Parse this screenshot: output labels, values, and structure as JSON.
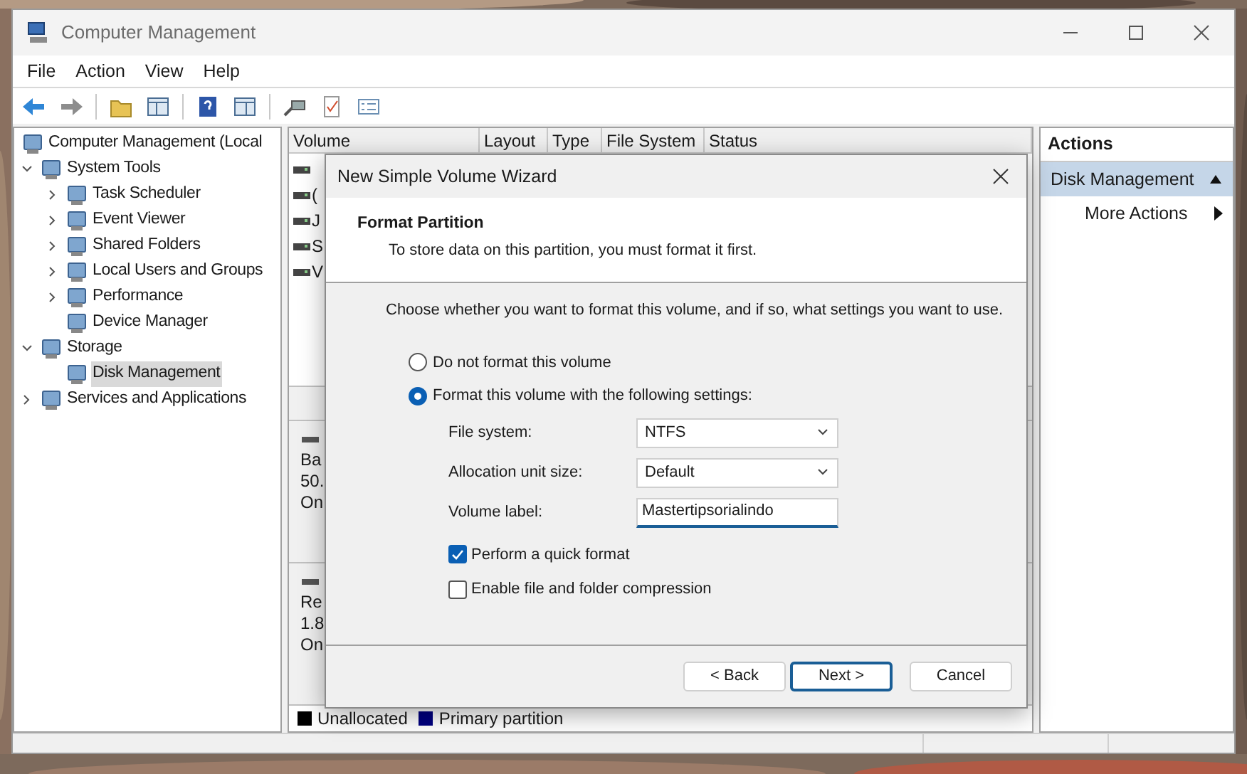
{
  "window": {
    "title": "Computer Management"
  },
  "menu": [
    "File",
    "Action",
    "View",
    "Help"
  ],
  "tree": [
    {
      "label": "Computer Management (Local",
      "selected": false,
      "children": [
        {
          "label": "System Tools",
          "expanded": true,
          "selected": false,
          "children": [
            {
              "label": "Task Scheduler",
              "expanded": false,
              "selected": false
            },
            {
              "label": "Event Viewer",
              "expanded": false,
              "selected": false
            },
            {
              "label": "Shared Folders",
              "expanded": false,
              "selected": false
            },
            {
              "label": "Local Users and Groups",
              "expanded": false,
              "selected": false
            },
            {
              "label": "Performance",
              "expanded": false,
              "selected": false
            },
            {
              "label": "Device Manager",
              "selected": false
            }
          ]
        },
        {
          "label": "Storage",
          "expanded": true,
          "selected": false,
          "children": [
            {
              "label": "Disk Management",
              "selected": true
            }
          ]
        },
        {
          "label": "Services and Applications",
          "expanded": false,
          "selected": false
        }
      ]
    }
  ],
  "volume_table": {
    "columns": [
      "Volume",
      "Layout",
      "Type",
      "File System",
      "Status"
    ],
    "rows": [
      {
        "text": ""
      },
      {
        "text": "("
      },
      {
        "text": "J"
      },
      {
        "text": "S"
      },
      {
        "text": "V"
      }
    ]
  },
  "disks": [
    {
      "lines": [
        "Ba",
        "50.",
        "On"
      ]
    },
    {
      "lines": [
        "Re",
        "1.8",
        "On"
      ]
    }
  ],
  "legend": [
    {
      "label": "Unallocated",
      "color": "#000000"
    },
    {
      "label": "Primary partition",
      "color": "#000080"
    }
  ],
  "actions": {
    "title": "Actions",
    "section": "Disk Management",
    "items": [
      "More Actions"
    ]
  },
  "dialog": {
    "title": "New Simple Volume Wizard",
    "heading": "Format Partition",
    "subheading": "To store data on this partition, you must format it first.",
    "prompt": "Choose whether you want to format this volume, and if so, what settings you want to use.",
    "options": [
      {
        "label": "Do not format this volume",
        "selected": false
      },
      {
        "label": "Format this volume with the following settings:",
        "selected": true
      }
    ],
    "settings": [
      {
        "kind": "dropdown",
        "label": "File system:",
        "value": "NTFS"
      },
      {
        "kind": "dropdown",
        "label": "Allocation unit size:",
        "value": "Default"
      },
      {
        "kind": "text",
        "label": "Volume label:",
        "value": "Mastertipsorialindo"
      }
    ],
    "checkboxes": [
      {
        "label": "Perform a quick format",
        "checked": true
      },
      {
        "label": "Enable file and folder compression",
        "checked": false
      }
    ],
    "buttons": [
      {
        "label": "< Back",
        "default": false
      },
      {
        "label": "Next >",
        "default": true
      },
      {
        "label": "Cancel",
        "default": false
      }
    ]
  }
}
